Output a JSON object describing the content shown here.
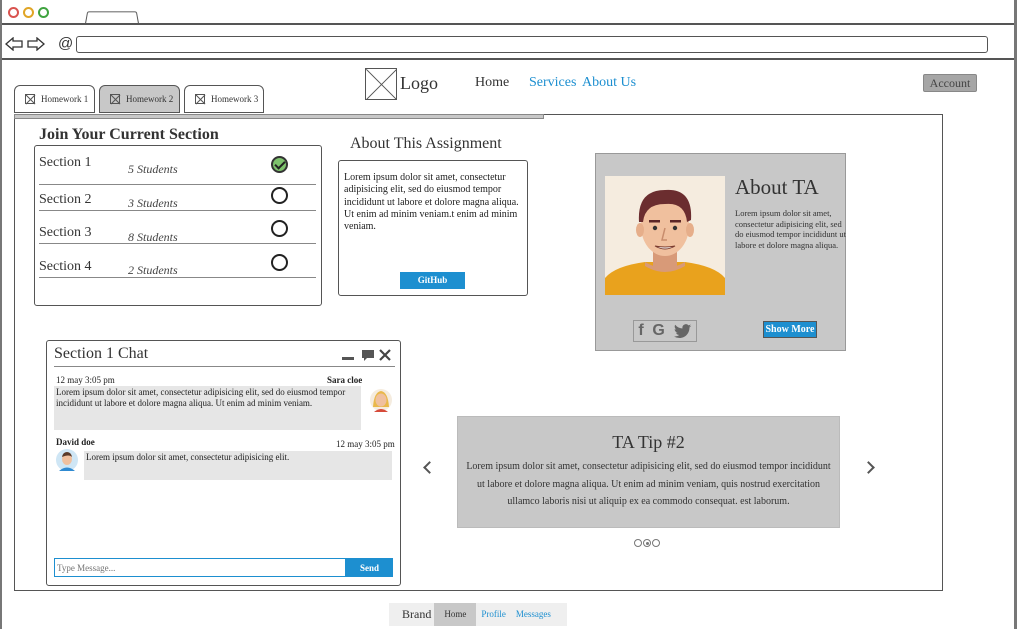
{
  "browser": {
    "url": ""
  },
  "homework_tabs": [
    {
      "label": "Homework 1"
    },
    {
      "label": "Homework 2"
    },
    {
      "label": "Homework 3"
    }
  ],
  "header": {
    "logo": "Logo",
    "nav": [
      "Home",
      "Services",
      "About Us"
    ],
    "account": "Account"
  },
  "sections": {
    "title": "Join Your Current Section",
    "rows": [
      {
        "name": "Section 1",
        "count": "5 Students",
        "selected": true
      },
      {
        "name": "Section 2",
        "count": "3 Students",
        "selected": false
      },
      {
        "name": "Section 3",
        "count": "8 Students",
        "selected": false
      },
      {
        "name": "Section 4",
        "count": "2 Students",
        "selected": false
      }
    ]
  },
  "assignment": {
    "title": "About This Assignment",
    "body": "Lorem ipsum dolor sit amet, consectetur adipisicing elit, sed do eiusmod tempor incididunt ut labore et dolore magna aliqua. Ut enim ad minim veniam.t enim ad minim veniam.",
    "github": "GitHub"
  },
  "ta": {
    "title": "About TA",
    "body": "Lorem ipsum dolor sit amet, consectetur adipisicing elit, sed do eiusmod tempor incididunt ut labore et dolore magna aliqua.",
    "social": [
      "f",
      "G"
    ],
    "show_more": "Show More"
  },
  "chat": {
    "title": "Section 1 Chat",
    "messages": [
      {
        "time": "12 may 3:05 pm",
        "author": "Sara cloe",
        "text": "Lorem ipsum dolor sit amet, consectetur adipisicing elit, sed do eiusmod tempor incididunt ut labore et dolore magna aliqua. Ut enim ad minim veniam."
      },
      {
        "author": "David doe",
        "time": "12 may 3:05 pm",
        "text": "Lorem ipsum dolor sit amet, consectetur adipisicing elit."
      }
    ],
    "placeholder": "Type Message...",
    "send": "Send"
  },
  "tip": {
    "title": "TA Tip #2",
    "body": "Lorem ipsum dolor sit amet, consectetur adipisicing elit, sed do eiusmod tempor incididunt ut labore et dolore magna aliqua. Ut enim ad minim veniam, quis nostrud exercitation ullamco laboris nisi ut aliquip ex ea commodo consequat. est laborum.",
    "active_dot": 2
  },
  "footer": {
    "brand": "Brand",
    "links": [
      "Home",
      "Profile",
      "Messages"
    ]
  },
  "colors": {
    "accent": "#1d8fd0",
    "panel": "#c8c8c8",
    "check": "#7ec26d"
  }
}
